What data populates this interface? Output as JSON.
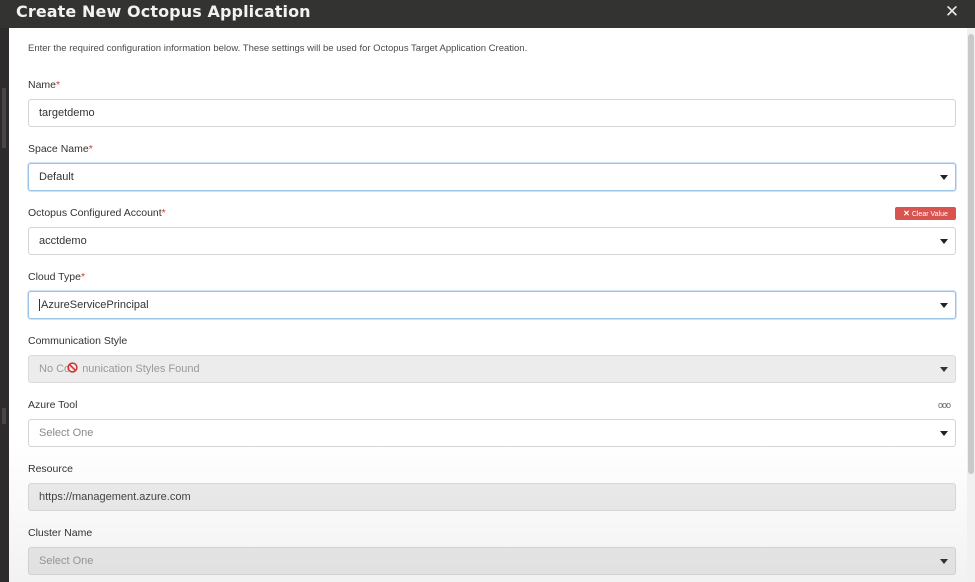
{
  "dialog": {
    "title": "Create New Octopus Application",
    "close_glyph": "✕",
    "intro": "Enter the required configuration information below. These settings will be used for Octopus Target Application Creation."
  },
  "required_marker": "*",
  "fields": {
    "name": {
      "label": "Name",
      "required": true,
      "value": "targetdemo"
    },
    "space_name": {
      "label": "Space Name",
      "required": true,
      "value": "Default"
    },
    "account": {
      "label": "Octopus Configured Account",
      "required": true,
      "value": "acctdemo",
      "clear_label": "Clear Value",
      "clear_glyph": "✕"
    },
    "cloud_type": {
      "label": "Cloud Type",
      "required": true,
      "value": "AzureServicePrincipal"
    },
    "communication_style": {
      "label": "Communication Style",
      "required": false,
      "value_left": "No Co",
      "value_right": "nunication Styles Found"
    },
    "azure_tool": {
      "label": "Azure Tool",
      "required": false,
      "value": "Select One",
      "more_glyph": "ooo"
    },
    "resource": {
      "label": "Resource",
      "required": false,
      "value": "https://management.azure.com"
    },
    "cluster_name": {
      "label": "Cluster Name",
      "required": false,
      "value": "Select One"
    }
  },
  "icons": {
    "close": "close-icon",
    "caret": "chevron-down-icon",
    "clear": "clear-icon",
    "more": "more-horizontal-icon",
    "not_allowed_cursor": "not-allowed-icon"
  },
  "colors": {
    "titlebar": "#333331",
    "required": "#d23b3b",
    "clear_badge": "#d9534f",
    "focus_border": "#9cc3e8",
    "disabled_field": "#ececec"
  }
}
